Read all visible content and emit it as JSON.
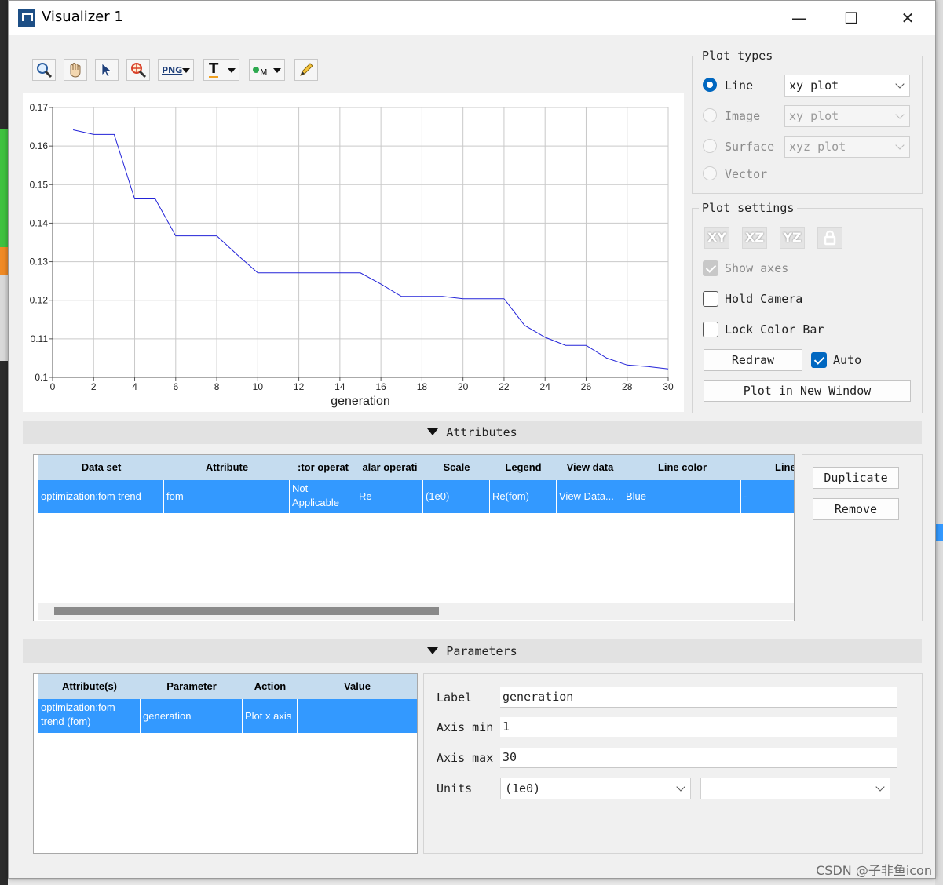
{
  "window": {
    "title": "Visualizer 1",
    "minimize": "—",
    "maximize": "☐",
    "close": "✕"
  },
  "toolbar": {
    "png_label": "PNG",
    "text_label": "T",
    "marker_label": "M"
  },
  "chart_data": {
    "type": "line",
    "xlabel": "generation",
    "ylabel": "",
    "title": "",
    "xlim": [
      0,
      30
    ],
    "ylim": [
      0.1,
      0.17
    ],
    "x_ticks": [
      "0",
      "2",
      "4",
      "6",
      "8",
      "10",
      "12",
      "14",
      "16",
      "18",
      "20",
      "22",
      "24",
      "26",
      "28",
      "30"
    ],
    "y_ticks": [
      "0.1",
      "0.11",
      "0.12",
      "0.13",
      "0.14",
      "0.15",
      "0.16",
      "0.17"
    ],
    "grid": true,
    "series": [
      {
        "color": "#2323d8",
        "x": [
          1,
          2,
          3,
          4,
          5,
          6,
          7,
          8,
          9,
          10,
          11,
          12,
          13,
          14,
          15,
          16,
          17,
          18,
          19,
          20,
          21,
          22,
          23,
          24,
          25,
          26,
          27,
          28,
          29,
          30
        ],
        "y": [
          0.1642,
          0.163,
          0.163,
          0.1463,
          0.1463,
          0.1367,
          0.1367,
          0.1367,
          0.1318,
          0.1271,
          0.1271,
          0.1271,
          0.1271,
          0.1271,
          0.1271,
          0.1242,
          0.121,
          0.121,
          0.121,
          0.1204,
          0.1204,
          0.1204,
          0.1135,
          0.1104,
          0.1083,
          0.1083,
          0.105,
          0.1032,
          0.1028,
          0.1022
        ]
      }
    ]
  },
  "plot_types": {
    "title": "Plot types",
    "rows": [
      {
        "label": "Line",
        "value": "xy plot",
        "selected": true
      },
      {
        "label": "Image",
        "value": "xy plot"
      },
      {
        "label": "Surface",
        "value": "xyz plot"
      },
      {
        "label": "Vector",
        "value": ""
      }
    ]
  },
  "plot_settings": {
    "title": "Plot settings",
    "views": [
      "XY",
      "XZ",
      "YZ"
    ],
    "show_axes": "Show axes",
    "hold_camera": "Hold Camera",
    "lock_color_bar": "Lock Color Bar",
    "redraw": "Redraw",
    "auto": "Auto",
    "plot_new_window": "Plot in New Window"
  },
  "attributes": {
    "section_title": "Attributes",
    "columns": [
      "Data set",
      "Attribute",
      ":tor operat",
      "alar operati",
      "Scale",
      "Legend",
      "View data",
      "Line color",
      "Line"
    ],
    "row": [
      "optimization:fom trend",
      "fom",
      "Not Applicable",
      "Re",
      "(1e0)",
      "Re(fom)",
      "View Data...",
      "Blue",
      "-"
    ],
    "duplicate": "Duplicate",
    "remove": "Remove"
  },
  "parameters": {
    "section_title": "Parameters",
    "columns": [
      "Attribute(s)",
      "Parameter",
      "Action",
      "Value"
    ],
    "row": [
      "optimization:fom trend (fom)",
      "generation",
      "Plot x axis",
      ""
    ],
    "label_label": "Label",
    "label_value": "generation",
    "axis_min_label": "Axis min",
    "axis_min_value": "1",
    "axis_max_label": "Axis max",
    "axis_max_value": "30",
    "units_label": "Units",
    "units_value": "(1e0)",
    "units_value2": ""
  },
  "watermark": "CSDN @子非鱼icon"
}
